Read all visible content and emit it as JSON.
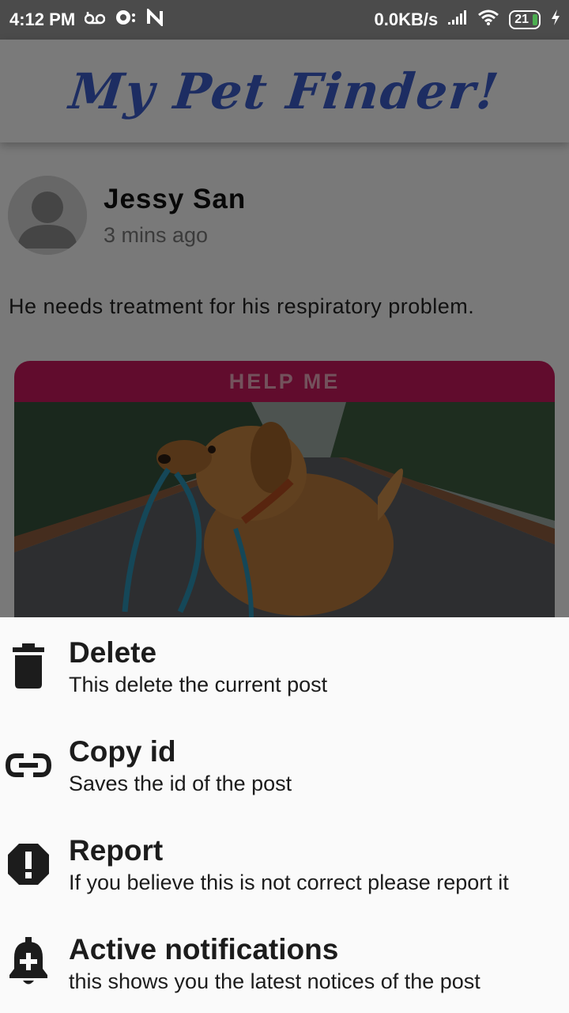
{
  "status_bar": {
    "time": "4:12 PM",
    "network_speed": "0.0KB/s",
    "battery": "21",
    "icons": [
      "voicemail-icon",
      "messenger-icon",
      "n-app-icon",
      "signal-icon",
      "wifi-icon",
      "battery-icon",
      "charging-icon"
    ]
  },
  "app_bar": {
    "title": "My Pet Finder!"
  },
  "post": {
    "author": "Jessy San",
    "time_ago": "3 mins ago",
    "description": "He needs treatment for his respiratory problem.",
    "card_label": "HELP ME",
    "image_subject": "golden retriever holding a blue leash on a forest road"
  },
  "bottom_sheet": {
    "items": [
      {
        "icon": "trash-icon",
        "title": "Delete",
        "subtitle": "This delete the current post"
      },
      {
        "icon": "link-icon",
        "title": "Copy id",
        "subtitle": "Saves the id of the post"
      },
      {
        "icon": "report-icon",
        "title": "Report",
        "subtitle": "If you believe this is not correct please report it"
      },
      {
        "icon": "notification-add-icon",
        "title": "Active notifications",
        "subtitle": "this shows you the latest notices of the post"
      }
    ]
  },
  "colors": {
    "title_blue": "#3a5bc4",
    "help_banner": "#c2185b",
    "status_bar": "#4b4b4b",
    "sheet_background": "#fafafa"
  }
}
